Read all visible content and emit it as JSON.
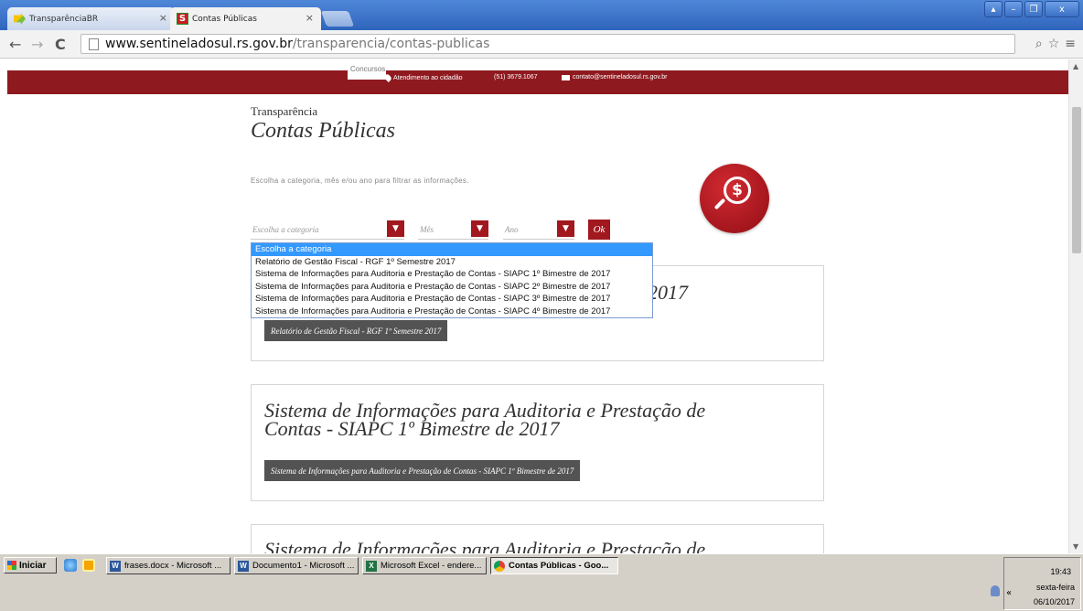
{
  "browser": {
    "tabs": [
      {
        "label": "TransparênciaBR",
        "active": false,
        "favicon": "yellow-arrow-icon"
      },
      {
        "label": "Contas Públicas",
        "active": true,
        "favicon": "s-logo-icon"
      }
    ],
    "tab_close": "×",
    "url_host": "www.sentineladosul.rs.gov.br",
    "url_path": "/transparencia/contas-publicas",
    "window_buttons": [
      "▴",
      "–",
      "❐",
      "x"
    ]
  },
  "site": {
    "concursos_label": "Concursos",
    "atendimento_label": "Atendimento ao cidadão",
    "phone": "(51) 3679.1067",
    "email": "contato@sentineladosul.rs.gov.br",
    "breadcrumb": "Transparência",
    "title": "Contas Públicas",
    "instructions": "Escolha a categoria, mês e/ou ano para filtrar as informações.",
    "badge_symbol": "$",
    "filters": {
      "category_placeholder": "Escolha a categoria",
      "month_placeholder": "Mês",
      "year_placeholder": "Ano",
      "ok_label": "Ok"
    },
    "dropdown_options": [
      "Escolha a categoria",
      "Relatório de Gestão Fiscal - RGF 1º Semestre 2017",
      "Sistema de Informações para Auditoria e Prestação de Contas - SIAPC 1º Bimestre de 2017",
      "Sistema de Informações para Auditoria e Prestação de Contas - SIAPC 2º Bimestre de 2017",
      "Sistema de Informações para Auditoria e Prestação de Contas - SIAPC 3º Bimestre de 2017",
      "Sistema de Informações para Auditoria e Prestação de Contas - SIAPC 4º Bimestre de 2017"
    ],
    "cards": [
      {
        "title_visible": "2017",
        "button": "Relatório de Gestão Fiscal - RGF 1º Semestre 2017"
      },
      {
        "title_line1": "Sistema de Informações para Auditoria e Prestação de",
        "title_line2": "Contas - SIAPC 1º Bimestre de 2017",
        "button": "Sistema de Informações para Auditoria e Prestação de Contas - SIAPC 1º Bimestre de 2017"
      },
      {
        "title_line1": "Sistema de Informações para Auditoria e Prestação de"
      }
    ]
  },
  "taskbar": {
    "start_label": "Iniciar",
    "tasks": [
      {
        "label": "frases.docx - Microsoft ...",
        "icon": "W"
      },
      {
        "label": "Documento1 - Microsoft ...",
        "icon": "W"
      },
      {
        "label": "Microsoft Excel - endere...",
        "icon": "X"
      },
      {
        "label": "Contas Públicas - Goo...",
        "icon": "chrome"
      }
    ],
    "chevron": "«",
    "time": "19:43",
    "weekday": "sexta-feira",
    "date": "06/10/2017"
  },
  "colors": {
    "brand_red": "#8e1a20",
    "button_red": "#a1181f",
    "selected_blue": "#3399ff"
  }
}
